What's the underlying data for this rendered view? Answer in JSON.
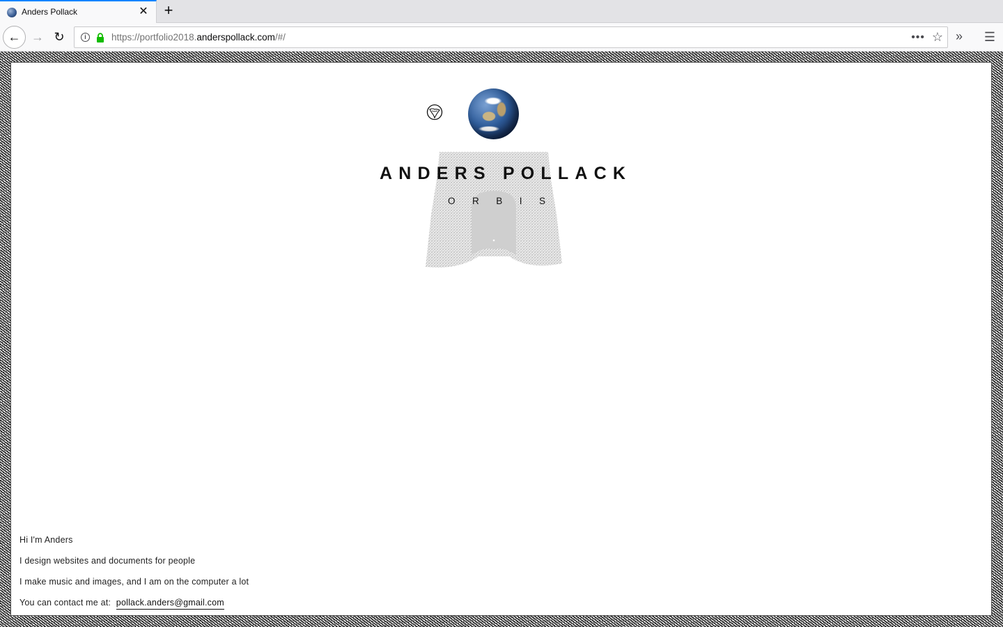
{
  "browser": {
    "tab_title": "Anders Pollack",
    "url_prefix": "https://portfolio2018.",
    "url_host": "anderspollack.com",
    "url_suffix": "/#/"
  },
  "site": {
    "title": "ANDERS POLLACK",
    "subtitle": "ORBIS"
  },
  "intro": {
    "line1": "Hi I'm Anders",
    "line2": "I design websites and documents for people",
    "line3": "I make music and images, and I am on the computer a lot",
    "contact_label": "You can contact me at:",
    "email": "pollack.anders@gmail.com"
  },
  "icons": {
    "tab_favicon": "earth-favicon-icon",
    "close": "close-icon",
    "new_tab": "plus-icon",
    "back": "back-arrow-icon",
    "forward": "forward-arrow-icon",
    "reload": "reload-icon",
    "info": "info-icon",
    "lock": "lock-icon",
    "page_actions": "more-dots-icon",
    "bookmark": "star-icon",
    "overflow": "double-chevron-icon",
    "menu": "hamburger-menu-icon",
    "mini_globe": "globe-outline-icon"
  },
  "colors": {
    "tab_accent": "#0a84ff",
    "lock_green": "#12bc00",
    "text": "#111111"
  }
}
